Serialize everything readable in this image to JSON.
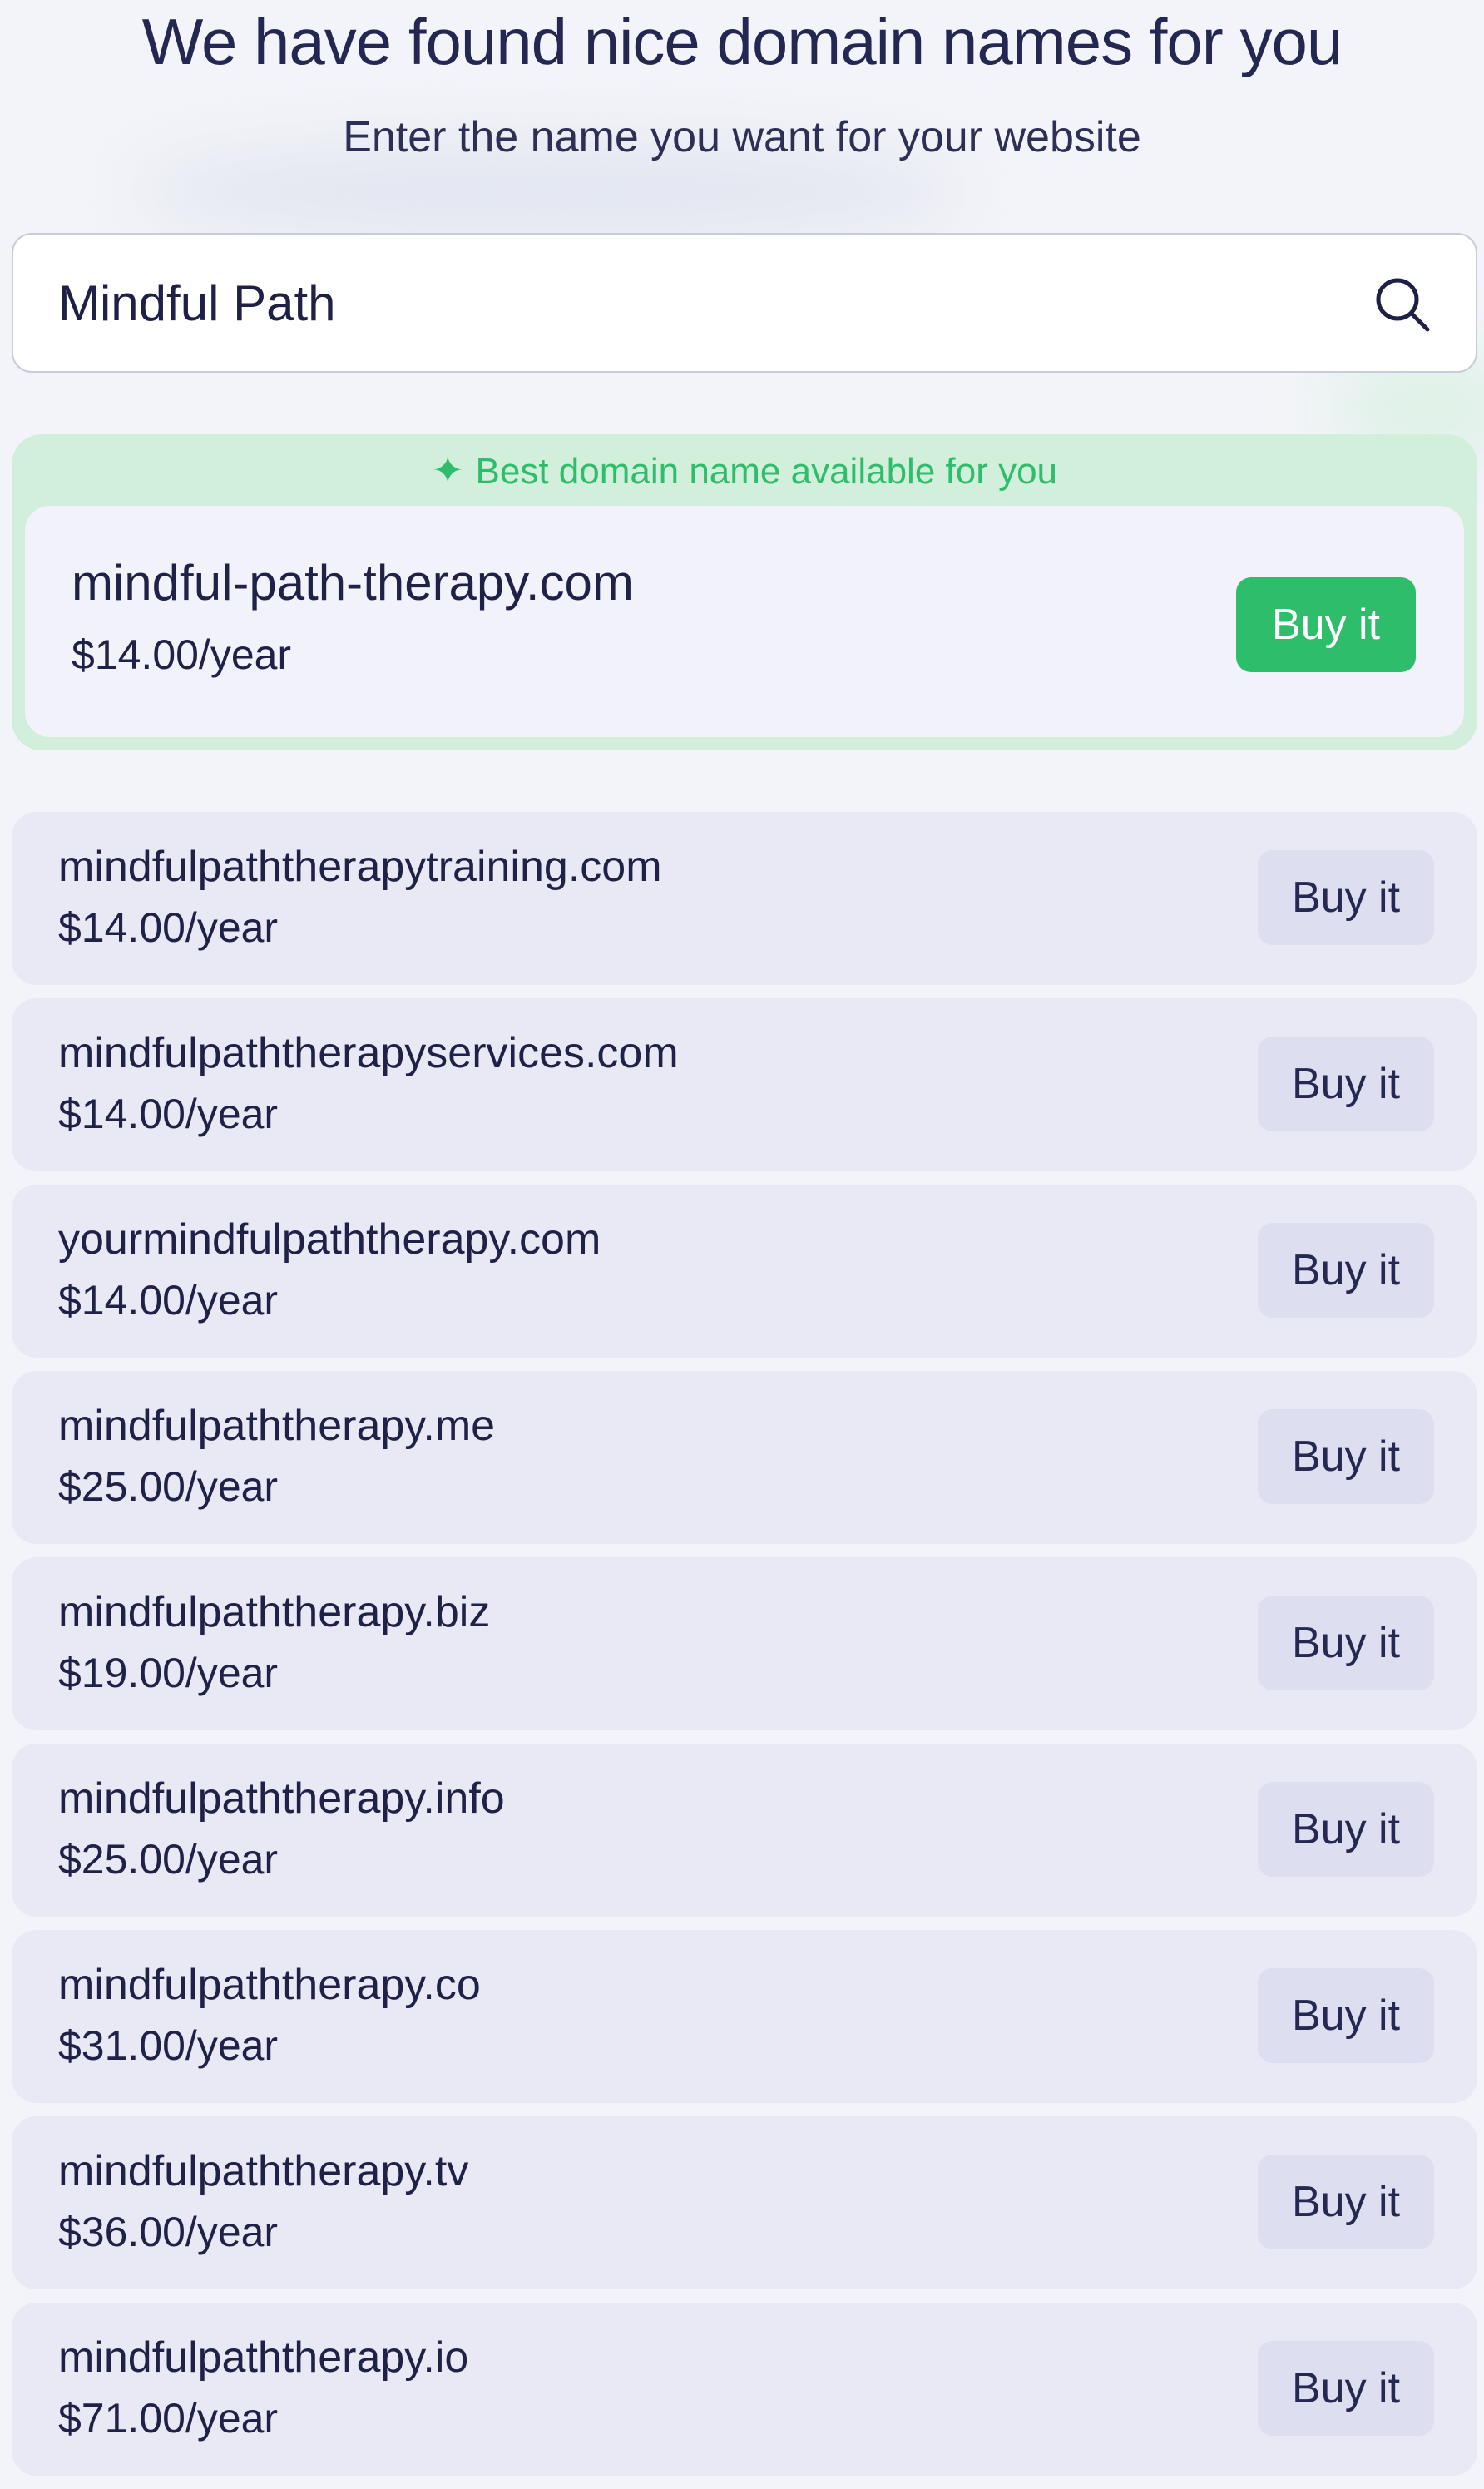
{
  "header": {
    "title": "We have found nice domain names for you",
    "subtitle": "Enter the name you want for your website"
  },
  "search": {
    "value": "Mindful Path",
    "icon": "search-icon"
  },
  "best": {
    "label": "Best domain name available for you",
    "label_icon": "sparkle-icon",
    "domain": "mindful-path-therapy.com",
    "price": "$14.00/year",
    "button_label": "Buy it",
    "accent_color": "#2ebd6b"
  },
  "results": [
    {
      "domain": "mindfulpaththerapytraining.com",
      "price": "$14.00/year",
      "button_label": "Buy it"
    },
    {
      "domain": "mindfulpaththerapyservices.com",
      "price": "$14.00/year",
      "button_label": "Buy it"
    },
    {
      "domain": "yourmindfulpaththerapy.com",
      "price": "$14.00/year",
      "button_label": "Buy it"
    },
    {
      "domain": "mindfulpaththerapy.me",
      "price": "$25.00/year",
      "button_label": "Buy it"
    },
    {
      "domain": "mindfulpaththerapy.biz",
      "price": "$19.00/year",
      "button_label": "Buy it"
    },
    {
      "domain": "mindfulpaththerapy.info",
      "price": "$25.00/year",
      "button_label": "Buy it"
    },
    {
      "domain": "mindfulpaththerapy.co",
      "price": "$31.00/year",
      "button_label": "Buy it"
    },
    {
      "domain": "mindfulpaththerapy.tv",
      "price": "$36.00/year",
      "button_label": "Buy it"
    },
    {
      "domain": "mindfulpaththerapy.io",
      "price": "$71.00/year",
      "button_label": "Buy it"
    }
  ]
}
